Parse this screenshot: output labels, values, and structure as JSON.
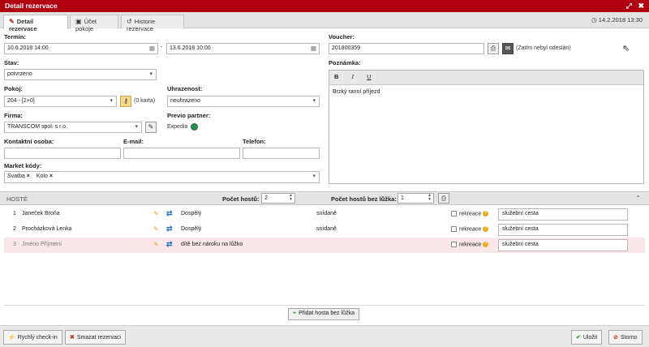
{
  "window": {
    "title": "Detail rezervace",
    "expand_glyph": "⤢",
    "close_glyph": "✖"
  },
  "tabs": [
    {
      "label": "Detail rezervace",
      "icon": "pencil-icon",
      "glyph": "✎"
    },
    {
      "label": "Účet pokoje",
      "icon": "money-icon",
      "glyph": "▣"
    },
    {
      "label": "Historie rezervace",
      "icon": "history-icon",
      "glyph": "↺"
    }
  ],
  "header": {
    "datetime": "14.2.2018 13:30",
    "clock_glyph": "◷"
  },
  "form": {
    "termin": {
      "label": "Termín:",
      "from": "10.6.2018 14:00",
      "dash": "-",
      "to": "13.6.2018 10:00",
      "cal_glyph": "▦"
    },
    "stav": {
      "label": "Stav:",
      "value": "potvrzeno"
    },
    "pokoj": {
      "label": "Pokoj:",
      "value": "204 - [2+0]",
      "karta": "(0 karta)"
    },
    "uhrazenost": {
      "label": "Uhrazenost:",
      "value": "neuhrazeno"
    },
    "firma": {
      "label": "Firma:",
      "value": "TRANSCOM spol. s r.o."
    },
    "partner": {
      "label": "Previo partner:",
      "value": "Expedia"
    },
    "kontakt": {
      "label": "Kontaktní osoba:",
      "value": ""
    },
    "email": {
      "label": "E-mail:",
      "value": ""
    },
    "telefon": {
      "label": "Telefon:",
      "value": ""
    },
    "market": {
      "label": "Market kódy:",
      "tags": [
        "Svatba",
        "Kolo"
      ],
      "remove_glyph": "×"
    },
    "voucher": {
      "label": "Voucher:",
      "value": "201800359",
      "status": "(Zatím nebyl odeslán)"
    },
    "poznamka": {
      "label": "Poznámka:",
      "bold": "B",
      "italic": "I",
      "underline": "U",
      "text": "Brzký ranní příjezd"
    },
    "caret": "▾"
  },
  "guests": {
    "header": "HOSTÉ",
    "count_label": "Počet hostů:",
    "count": "2",
    "nobed_label": "Počet hostů bez lůžka:",
    "nobed_count": "1",
    "spin_glyph": "▲▼",
    "collapse_glyph": "⌃",
    "rows": [
      {
        "n": "1",
        "name": "Janeček Broňa",
        "type": "Dospělý",
        "meal": "snídaně",
        "rekreace": "rekreace",
        "purpose": "služební cesta"
      },
      {
        "n": "2",
        "name": "Procházková Lenka",
        "type": "Dospělý",
        "meal": "snídaně",
        "rekreace": "rekreace",
        "purpose": "služební cesta"
      },
      {
        "n": "3",
        "name": "Jméno Příjmení",
        "type": "dítě bez nároku na lůžko",
        "meal": "",
        "rekreace": "rekreace",
        "purpose": "služební cesta"
      }
    ],
    "pencil_glyph": "✎",
    "swap_glyph": "⇄",
    "help_glyph": "?",
    "add_button": "Přidat hosta bez lůžka",
    "plus_glyph": "+"
  },
  "footer": {
    "checkin": "Rychlý check-in",
    "checkin_glyph": "⚡",
    "delete": "Smazat rezervaci",
    "delete_glyph": "✖",
    "save": "Uložit",
    "save_glyph": "✔",
    "storno": "Storno",
    "storno_glyph": "⊘"
  },
  "colors": {
    "titlebar": "#b0000f",
    "accent_green": "#3a9a35",
    "accent_orange": "#e3a12b"
  }
}
